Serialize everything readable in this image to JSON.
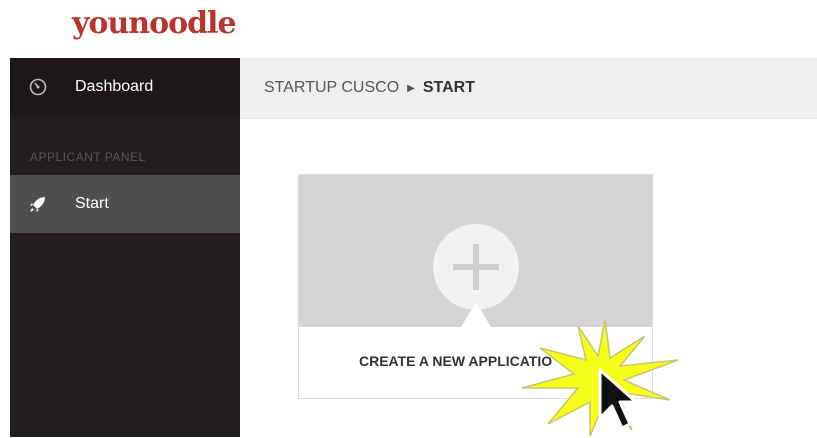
{
  "logo": {
    "text": "younoodle",
    "color": "#c0392b"
  },
  "sidebar": {
    "items": [
      {
        "label": "Dashboard",
        "icon": "dashboard-icon"
      },
      {
        "label": "Start",
        "icon": "rocket-icon",
        "active": true
      }
    ],
    "section_label": "APPLICANT PANEL"
  },
  "breadcrumb": {
    "parent": "STARTUP CUSCO",
    "separator": "▶",
    "current": "START"
  },
  "card": {
    "label": "CREATE A NEW APPLICATIO",
    "icon": "plus-icon"
  },
  "cursor": {
    "icon": "mouse-pointer-icon",
    "highlight": "click-burst-icon",
    "highlight_color": "#f5ff1a"
  }
}
